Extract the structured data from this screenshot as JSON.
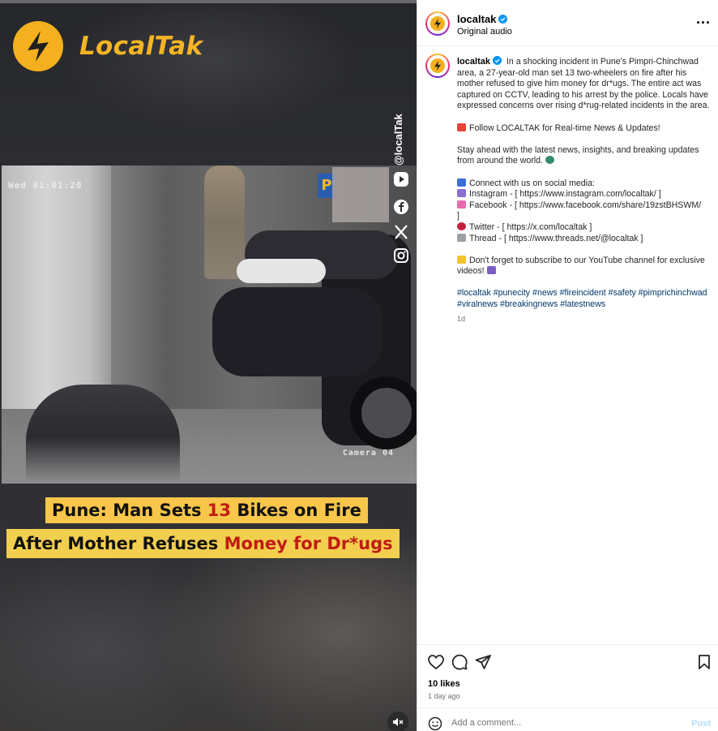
{
  "media": {
    "brand": "LocalTak",
    "handle": "@localTak",
    "cctv_timestamp": "Wed 01:01:20",
    "camera_label": "Camera 04",
    "headline_line1": {
      "a": "Pune: Man Sets ",
      "b": "13",
      "c": " Bikes on Fire"
    },
    "headline_line2": {
      "a": "After Mother Refuses ",
      "b": "Money for Dr*ugs"
    },
    "side_icons": [
      "youtube-icon",
      "facebook-icon",
      "x-icon",
      "instagram-icon"
    ],
    "mute_icon": "speaker-muted-icon"
  },
  "header": {
    "username": "localtak",
    "subtitle": "Original audio",
    "more_icon": "more-options-icon"
  },
  "caption": {
    "username": "localtak",
    "text": "In a shocking incident in Pune's Pimpri-Chinchwad area, a 27-year-old man set 13 two-wheelers on fire after his mother refused to give him money for dr*ugs. The entire act was captured on CCTV, leading to his arrest by the police. Locals have expressed concerns over rising d*rug-related incidents in the area.",
    "follow": "Follow LOCALTAK for Real-time News & Updates!",
    "stay_ahead": "Stay ahead with the latest news, insights, and breaking updates from around the world.",
    "connect": "Connect with us on social media:",
    "instagram": "Instagram - [ https://www.instagram.com/localtak/ ]",
    "facebook": "Facebook - [ https://www.facebook.com/share/19zstBHSWM/",
    "facebook_end": "]",
    "twitter": "Twitter - [ https://x.com/localtak ]",
    "thread": "Thread - [ https://www.threads.net/@localtak ]",
    "subscribe": "Don't forget to subscribe to our YouTube channel for exclusive videos!",
    "hashtags": "#localtak #punecity #news #fireincident #safety #pimprichinchwad #viralnews #breakingnews #latestnews",
    "age": "1d"
  },
  "actions": {
    "icons": [
      "heart-icon",
      "comment-icon",
      "share-icon",
      "bookmark-icon"
    ],
    "likes": "10 likes",
    "date": "1 day ago"
  },
  "comment_box": {
    "placeholder": "Add a comment...",
    "post_label": "Post"
  },
  "colors": {
    "brand_yellow": "#f5b523",
    "headline_red": "#c11b12",
    "link_blue": "#00376b",
    "verified_blue": "#0095f6"
  }
}
